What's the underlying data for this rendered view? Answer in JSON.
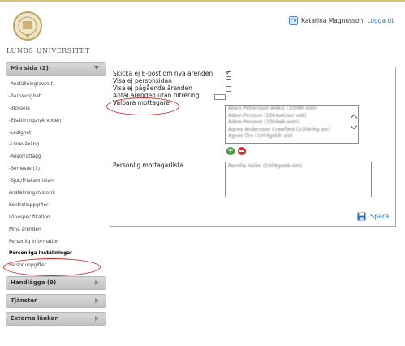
{
  "header": {
    "university": "LUNDS UNIVERSITET",
    "user_name": "Katarina Magnusson",
    "logout_label": "Logga ut"
  },
  "sidebar": {
    "my_page": {
      "label": "Min sida (2)",
      "items": [
        "-Anställning/avslut",
        "-Barnledighet",
        "-Blossola",
        "-Ersättningar/Arvoden",
        "-Ledighet",
        "-Löneväxling",
        "-Resorrattägg",
        "-Semester(1)",
        "-Sjuk/Friskanmälan",
        "Anställningshistorik",
        "Kontrolluppgifter",
        "Lönespecifikation",
        "Mina ärenden",
        "Personlig information",
        "Personliga inställningar",
        "Personuppgifter"
      ],
      "active_item": "Personliga inställningar"
    },
    "sections": [
      {
        "label": "Handlägga (9)"
      },
      {
        "label": "Tjänster"
      },
      {
        "label": "Externa länkar"
      }
    ]
  },
  "settings": {
    "options": [
      {
        "label": "Skicka ej E-post om nya ärenden",
        "checked": true
      },
      {
        "label": "Visa ej personsidan",
        "checked": false
      },
      {
        "label": "Visa ej pågående ärenden",
        "checked": false
      },
      {
        "label": "Antal ärenden utan filtrering",
        "value": ""
      }
    ],
    "selectable_recipients_label": "Valbara mottagare",
    "selectable_recipients": [
      "Abavi Pettersson Aleksi (1008h som)",
      "Adam Persson (1004wk/ser vkk)",
      "Adam Persson (1004wk-sem)",
      "Agnes Andersson Crawfield (1004vkg sor)",
      "Agnes Ore (1004gskih als)"
    ],
    "personal_list_label": "Personlig mottagarlista",
    "personal_recipients": [
      "Pernilla Hylén (1004gsmk-dm)"
    ],
    "save_label": "Spara"
  },
  "icons": {
    "add": "plus-circle-icon",
    "remove": "minus-circle-icon",
    "save": "floppy-disk-icon",
    "user": "user-refresh-icon"
  },
  "colors": {
    "accent_gold": "#d9c27a",
    "highlight_red": "#cc2a2a",
    "link_blue": "#2a6fb8",
    "add_green": "#3f9a3a",
    "remove_red": "#d82c2c"
  }
}
